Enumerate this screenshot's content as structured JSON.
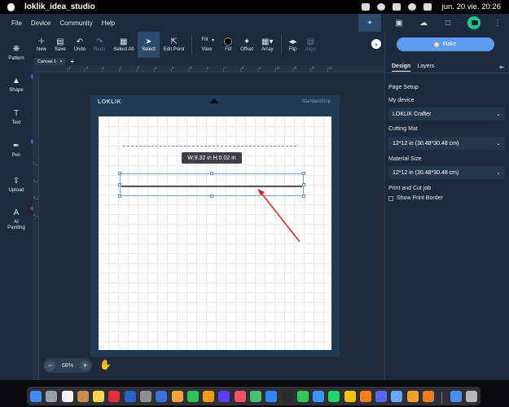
{
  "os": {
    "app_name": "loklik_idea_studio",
    "clock": "jun. 20 vie. 20:26"
  },
  "menu": [
    "File",
    "Device",
    "Community",
    "Help"
  ],
  "toolbar": {
    "new": "New",
    "save": "Save",
    "undo": "Undo",
    "redo": "Redo",
    "select_all": "Select All",
    "select": "Select",
    "edit_point": "Edit Point",
    "view_value": "Fill",
    "view": "View",
    "fill": "Fill",
    "offset": "Offset",
    "array": "Array",
    "flip": "Flip",
    "align": "Align"
  },
  "sidebar": {
    "pattern": "Pattern",
    "shape": "Shape",
    "text": "Text",
    "pen": "Pen",
    "upload": "Upload",
    "ai_painting_line1": "AI",
    "ai_painting_line2": "Painting",
    "new_badge": "New"
  },
  "canvas": {
    "tab_label": "Canvas 1",
    "close_glyph": "×",
    "add_glyph": "+",
    "mat_brand": "LOKLIK",
    "mat_type": "StandardGrip",
    "size_tooltip": "W:9.32 in  H:0.02 in",
    "zoom_percent": "68%",
    "zoom_minus": "−",
    "zoom_plus": "+"
  },
  "ruler": {
    "h_ticks": [
      "-2",
      "-1",
      "0",
      "1",
      "2",
      "3",
      "4",
      "5",
      "6",
      "7",
      "8",
      "9",
      "10",
      "11",
      "12",
      "13"
    ],
    "v_ticks": [
      "1",
      "2",
      "3",
      "4"
    ]
  },
  "panel": {
    "make_label": "Make",
    "tab_design": "Design",
    "tab_layers": "Layers",
    "page_setup": "Page Setup",
    "my_device_label": "My device",
    "my_device_value": "LOKLiK Crafter",
    "cutting_mat_label": "Cutting Mat",
    "cutting_mat_value": "12*12 in (30.48*30.48 cm)",
    "material_size_label": "Material Size",
    "material_size_value": "12*12 in (30.48*30.48 cm)",
    "print_cut_label": "Print and Cut job",
    "show_print_border": "Show Print Border"
  },
  "colors": {
    "accent": "#5b9cf0",
    "chrome": "#1b2a3d",
    "annotation_arrow": "#e02020"
  },
  "icons": {
    "trash": "trash-icon",
    "hand": "hand-icon",
    "gear": "gear-icon"
  },
  "dock_apps": [
    "finder",
    "launchpad",
    "calendar",
    "contacts",
    "notes",
    "opera",
    "photoshop",
    "settings",
    "inbox",
    "pages",
    "facetime",
    "illustrator",
    "premiere",
    "music",
    "maps",
    "app-store",
    "terminal",
    "messages",
    "safari",
    "whatsapp",
    "chrome",
    "firefox",
    "discord",
    "preview",
    "kindle",
    "blender",
    "downloads",
    "trash"
  ]
}
